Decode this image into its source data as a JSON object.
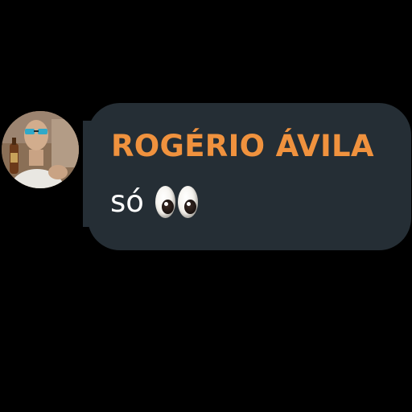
{
  "message": {
    "author": "ROGÉRIO ÁVILA",
    "text": "só",
    "emoji": "eyes-emoji"
  },
  "colors": {
    "background": "#000000",
    "bubble": "#252e35",
    "author_name": "#f0923e",
    "message_text": "#ffffff"
  },
  "avatar": {
    "icon": "user-profile-photo"
  }
}
